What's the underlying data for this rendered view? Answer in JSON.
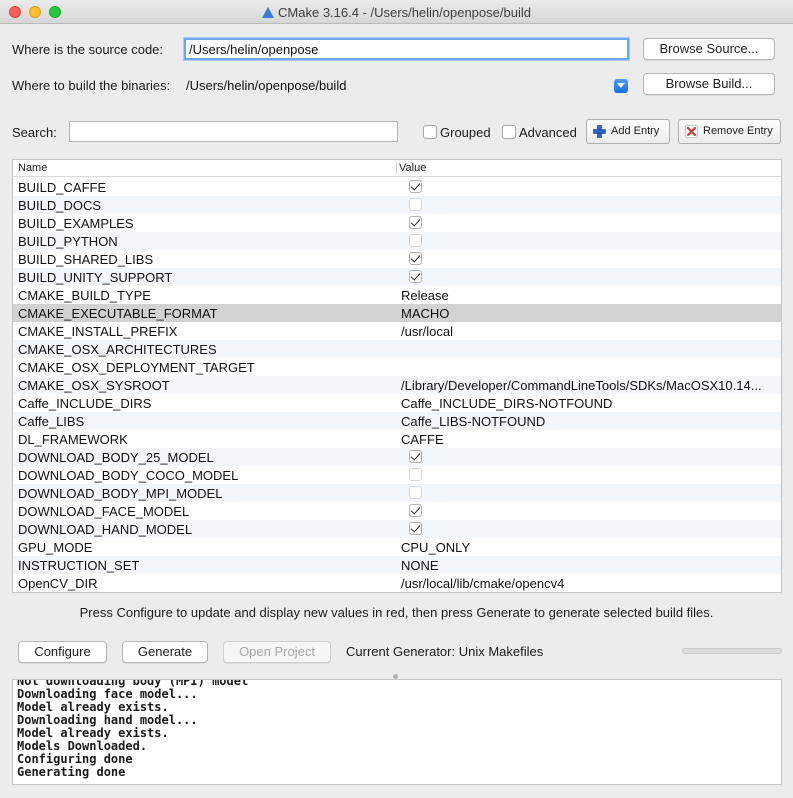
{
  "window": {
    "title": "CMake 3.16.4 - /Users/helin/openpose/build"
  },
  "source": {
    "label": "Where is the source code:",
    "value": "/Users/helin/openpose",
    "browse_label": "Browse Source..."
  },
  "build": {
    "label": "Where to build the binaries:",
    "value": "/Users/helin/openpose/build",
    "browse_label": "Browse Build..."
  },
  "search": {
    "label": "Search:",
    "value": ""
  },
  "filters": {
    "grouped_label": "Grouped",
    "grouped_checked": false,
    "advanced_label": "Advanced",
    "advanced_checked": false
  },
  "toolbar": {
    "add_entry": "Add Entry",
    "remove_entry": "Remove Entry"
  },
  "table": {
    "headers": {
      "name": "Name",
      "value": "Value"
    },
    "rows": [
      {
        "name": "BUILD_CAFFE",
        "type": "bool",
        "checked": true
      },
      {
        "name": "BUILD_DOCS",
        "type": "bool",
        "checked": false
      },
      {
        "name": "BUILD_EXAMPLES",
        "type": "bool",
        "checked": true
      },
      {
        "name": "BUILD_PYTHON",
        "type": "bool",
        "checked": false
      },
      {
        "name": "BUILD_SHARED_LIBS",
        "type": "bool",
        "checked": true
      },
      {
        "name": "BUILD_UNITY_SUPPORT",
        "type": "bool",
        "checked": true
      },
      {
        "name": "CMAKE_BUILD_TYPE",
        "type": "text",
        "value": "Release"
      },
      {
        "name": "CMAKE_EXECUTABLE_FORMAT",
        "type": "text",
        "value": "MACHO",
        "selected": true
      },
      {
        "name": "CMAKE_INSTALL_PREFIX",
        "type": "text",
        "value": "/usr/local"
      },
      {
        "name": "CMAKE_OSX_ARCHITECTURES",
        "type": "text",
        "value": ""
      },
      {
        "name": "CMAKE_OSX_DEPLOYMENT_TARGET",
        "type": "text",
        "value": ""
      },
      {
        "name": "CMAKE_OSX_SYSROOT",
        "type": "text",
        "value": "/Library/Developer/CommandLineTools/SDKs/MacOSX10.14..."
      },
      {
        "name": "Caffe_INCLUDE_DIRS",
        "type": "text",
        "value": "Caffe_INCLUDE_DIRS-NOTFOUND"
      },
      {
        "name": "Caffe_LIBS",
        "type": "text",
        "value": "Caffe_LIBS-NOTFOUND"
      },
      {
        "name": "DL_FRAMEWORK",
        "type": "text",
        "value": "CAFFE"
      },
      {
        "name": "DOWNLOAD_BODY_25_MODEL",
        "type": "bool",
        "checked": true
      },
      {
        "name": "DOWNLOAD_BODY_COCO_MODEL",
        "type": "bool",
        "checked": false
      },
      {
        "name": "DOWNLOAD_BODY_MPI_MODEL",
        "type": "bool",
        "checked": false
      },
      {
        "name": "DOWNLOAD_FACE_MODEL",
        "type": "bool",
        "checked": true
      },
      {
        "name": "DOWNLOAD_HAND_MODEL",
        "type": "bool",
        "checked": true
      },
      {
        "name": "GPU_MODE",
        "type": "text",
        "value": "CPU_ONLY"
      },
      {
        "name": "INSTRUCTION_SET",
        "type": "text",
        "value": "NONE"
      },
      {
        "name": "OpenCV_DIR",
        "type": "text",
        "value": "/usr/local/lib/cmake/opencv4"
      }
    ]
  },
  "hint": "Press Configure to update and display new values in red, then press Generate to generate selected build files.",
  "actions": {
    "configure": "Configure",
    "generate": "Generate",
    "open_project": "Open Project",
    "generator": "Current Generator: Unix Makefiles",
    "progress": 0
  },
  "output": {
    "lines": [
      "Not downloading body (MPI) model",
      "Downloading face model...",
      "Model already exists.",
      "Downloading hand model...",
      "Model already exists.",
      "Models Downloaded.",
      "Configuring done",
      "Generating done"
    ]
  },
  "colors": {
    "focus_ring": "#6da6ec",
    "row_alt": "#f3f6fa",
    "row_selected": "#d2d2d2",
    "add_icon": "#2b5fc9",
    "remove_icon": "#d23b2f"
  }
}
